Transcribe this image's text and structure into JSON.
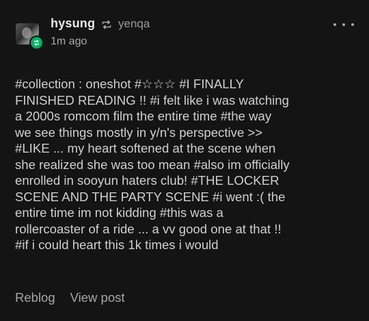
{
  "post": {
    "username": "hysung",
    "reblogged_from": "yenqa",
    "timestamp": "1m ago",
    "tags_lines": [
      "#collection : oneshot  #☆☆☆  #I FINALLY",
      "FINISHED READING !!  #i felt like i was watching",
      "a 2000s romcom film the entire time  #the way",
      "we see things mostly in y/n's perspective >>",
      "#LIKE ... my heart softened at the scene when",
      "she realized she was too mean  #also im officially",
      "enrolled in sooyun haters club!  #THE LOCKER",
      "SCENE AND THE PARTY SCENE  #i went :( the",
      "entire time im not kidding  #this was a",
      "rollercoaster of a ride ... a vv good one at that !!",
      "#if i could heart this 1k times i would"
    ]
  },
  "actions": {
    "reblog_label": "Reblog",
    "view_post_label": "View post"
  },
  "icons": {
    "more": "more-dots-icon",
    "reblog": "reblog-arrows-icon",
    "badge": "reblog-badge-icon"
  },
  "colors": {
    "background": "#141414",
    "badge_green": "#00b15e",
    "text": "#cfcfcf"
  }
}
